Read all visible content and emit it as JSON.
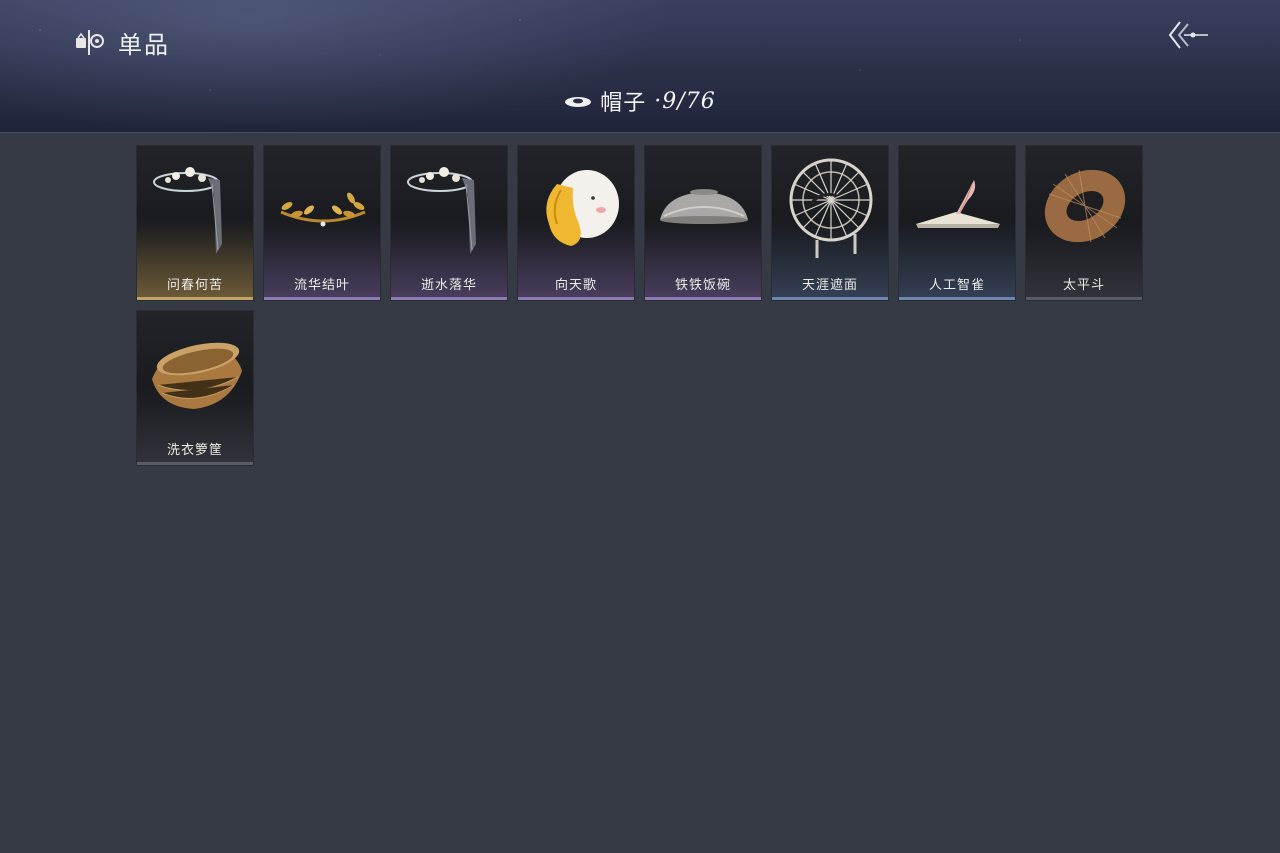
{
  "header": {
    "section_label": "单品",
    "category_label": "帽子",
    "count": "·9/76"
  },
  "icons": {
    "section": "wardrobe-icon",
    "back": "back-arrow-icon",
    "category": "hat-icon"
  },
  "items": [
    {
      "name": "问春何苦",
      "rarity": "gold"
    },
    {
      "name": "流华结叶",
      "rarity": "purple"
    },
    {
      "name": "逝水落华",
      "rarity": "purple"
    },
    {
      "name": "向天歌",
      "rarity": "purple"
    },
    {
      "name": "铁铁饭碗",
      "rarity": "purple"
    },
    {
      "name": "天涯遮面",
      "rarity": "blue"
    },
    {
      "name": "人工智雀",
      "rarity": "blue"
    },
    {
      "name": "太平斗",
      "rarity": "gray"
    },
    {
      "name": "洗衣箩筐",
      "rarity": "gray"
    }
  ],
  "colors": {
    "background": "#363a44",
    "gold": "#c2a468",
    "purple": "#8b79b3",
    "blue": "#6d86ad"
  }
}
